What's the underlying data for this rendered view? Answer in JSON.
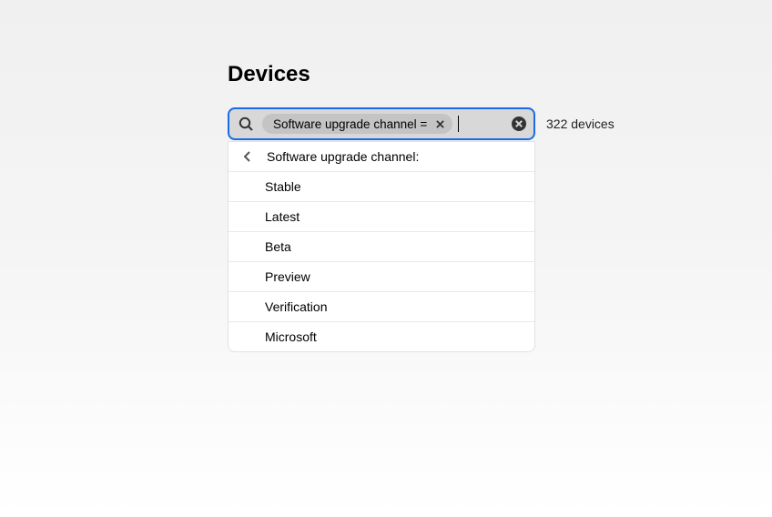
{
  "page": {
    "title": "Devices"
  },
  "search": {
    "filter_chip": "Software upgrade channel =",
    "device_count": "322 devices"
  },
  "dropdown": {
    "header": "Software upgrade channel:",
    "options": [
      "Stable",
      "Latest",
      "Beta",
      "Preview",
      "Verification",
      "Microsoft"
    ]
  }
}
